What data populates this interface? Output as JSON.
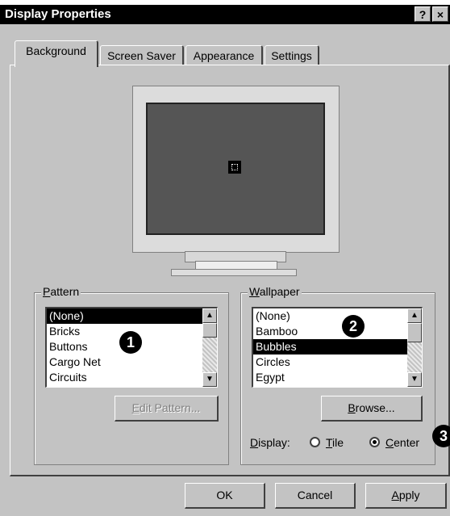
{
  "window": {
    "title": "Display Properties",
    "help_button": "?",
    "close_button": "×"
  },
  "tabs": [
    {
      "label": "Background",
      "active": true
    },
    {
      "label": "Screen Saver",
      "active": false
    },
    {
      "label": "Appearance",
      "active": false
    },
    {
      "label": "Settings",
      "active": false
    }
  ],
  "pattern": {
    "label_accel": "P",
    "label_rest": "attern",
    "items": [
      "(None)",
      "Bricks",
      "Buttons",
      "Cargo Net",
      "Circuits"
    ],
    "selected_index": 0,
    "edit_button_accel": "E",
    "edit_button_rest": "dit Pattern..."
  },
  "wallpaper": {
    "label_accel": "W",
    "label_rest": "allpaper",
    "items": [
      "(None)",
      "Bamboo",
      "Bubbles",
      "Circles",
      "Egypt"
    ],
    "selected_index": 2,
    "browse_accel": "B",
    "browse_rest": "rowse..."
  },
  "display": {
    "label_accel": "D",
    "label_rest": "isplay:",
    "tile_accel": "T",
    "tile_rest": "ile",
    "center_accel": "C",
    "center_rest": "enter",
    "selected": "center"
  },
  "callouts": [
    "1",
    "2",
    "3"
  ],
  "buttons": {
    "ok": "OK",
    "cancel": "Cancel",
    "apply_accel": "A",
    "apply_rest": "pply"
  },
  "icons": {
    "up": "up-arrow-icon",
    "down": "down-arrow-icon"
  }
}
